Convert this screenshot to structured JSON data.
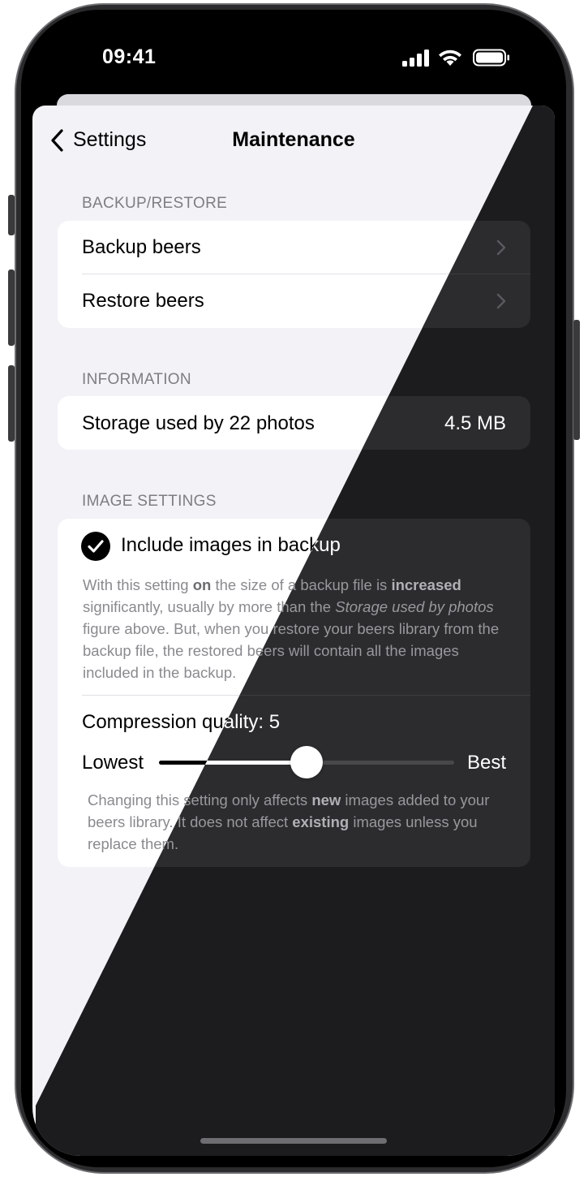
{
  "status_bar": {
    "time": "09:41"
  },
  "nav": {
    "back_label": "Settings",
    "title": "Maintenance"
  },
  "sections": {
    "backup_restore": {
      "header": "BACKUP/RESTORE",
      "rows": [
        {
          "label": "Backup beers"
        },
        {
          "label": "Restore beers"
        }
      ]
    },
    "information": {
      "header": "INFORMATION",
      "storage_label": "Storage used by 22 photos",
      "storage_value": "4.5 MB"
    },
    "image_settings": {
      "header": "IMAGE SETTINGS",
      "include_images_label": "Include images in backup",
      "include_images_checked": true,
      "description_parts": [
        "With this setting ",
        "on",
        " the size of a backup file is ",
        "increased",
        " significantly, usually by more than the ",
        "Storage used by photos",
        " figure above. But, when you restore your beers library from the backup file, the restored beers will contain all the images included in the backup."
      ],
      "compression_label": "Compression quality: 5",
      "slider_min_label": "Lowest",
      "slider_max_label": "Best",
      "slider_fraction": 0.5,
      "note_parts": [
        "Changing this setting only affects ",
        "new",
        " images added to your beers library. It does not affect ",
        "existing",
        " images unless you replace them."
      ]
    }
  },
  "colors": {
    "light_background": "#f2f2f7",
    "dark_background": "#1c1c1e",
    "light_cell": "#ffffff",
    "dark_cell": "#2c2c2e"
  }
}
